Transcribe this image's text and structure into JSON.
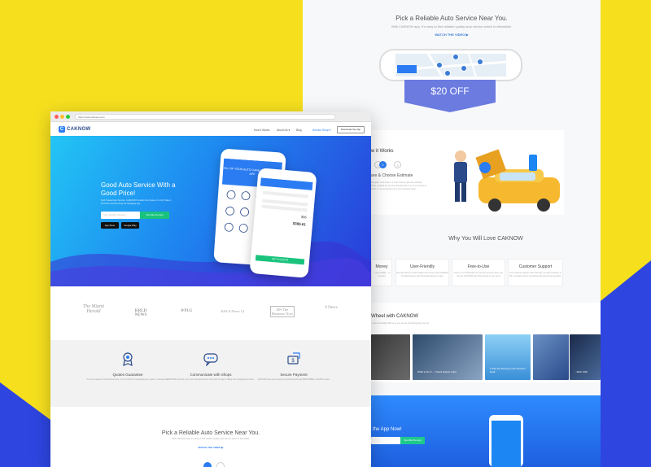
{
  "colors": {
    "background_yellow": "#f6e01e",
    "background_blue": "#2e45e0",
    "brand_blue": "#2b7cf2",
    "cta_green": "#19c37d",
    "offer_purple": "#6b7be0"
  },
  "browser": {
    "url": "https://www.caknow.com"
  },
  "nav": {
    "logo_mark": "C",
    "logo_text": "CAKNOW",
    "items": [
      "How it Works",
      "About Us ▾",
      "Blog",
      "Service Shop ▾"
    ],
    "download_button": "Download the App"
  },
  "hero": {
    "headline": "Good Auto Service With a Good Price!",
    "description": "Find Trusted Auto Service. CAKNOW Provides the Quotes, It's Only Take A Pin Point Can Be Using the Shopping app.",
    "input_placeholder": "Your Mobile Number",
    "cta_button": "Text Me the App",
    "app_store": "App Store",
    "google_play": "Google Play",
    "phone_banner": "ALL OF YOUR AUTO CARE NEEDS IN ONE APP",
    "phone_price": "$396.61",
    "phone_price_small": "$96",
    "phone_quote_button": "GET A QUOTE"
  },
  "press": {
    "logos": [
      "The Miami Herald",
      "KRLD NEWS",
      "WPLG",
      "KSLA News 12",
      "BN The Business Now",
      "9 News"
    ]
  },
  "features": [
    {
      "icon": "award-icon",
      "title": "Quotes Guarantee",
      "desc": "Get more quotes to find the best price, up to 24 hours of requesting your repair or maintenance."
    },
    {
      "icon": "chat-icon",
      "title": "Communicate with Shops",
      "desc": "CAKNOW connects you to your selected service shop with our app's calling and messaging functions."
    },
    {
      "icon": "secure-payment-icon",
      "title": "Secure Payment",
      "desc": "CAKNOW uses secure payment processing through BRAINTREE, a PayPal service."
    }
  ],
  "pick": {
    "title": "Pick a Reliable Auto Service Near You.",
    "subtitle": "With CAKNOW app, it's easy to find reliable quality auto service which is affordable.",
    "watch_link": "WATCH THE VIDEO"
  },
  "back_page": {
    "pick_title": "Pick a Reliable Auto Service Near You.",
    "pick_subtitle": "With CAKNOW app, it's easy to find reliable quality auto service which is affordable.",
    "watch_link": "WATCH THE VIDEO",
    "offer": "$20 OFF",
    "how_title": "w it Works",
    "how_step_label": "are & Choose Estimate",
    "how_text": "Compare more than 1 or 3 but more to give the estimate, these, enlisted the service estimate that on yu is on fit shop to arrive, or can to trusted exit it your personal inbox.",
    "steps": [
      "1",
      "2",
      "3"
    ],
    "love_title": "Why You Will Love CAKNOW",
    "love_cards": [
      {
        "title": "Money",
        "desc": "...ness reliable\n...ut services"
      },
      {
        "title": "User-Friendly",
        "desc": "We help drivers to find reliable and service shop available for appointment, and book appointment in app."
      },
      {
        "title": "Free-to-Use",
        "desc": "There is no subscription to connect services when you use the CAKNOW app. Book shops in your area."
      },
      {
        "title": "Customer Support",
        "desc": "Our customer support team will help you with questions in 24h, and take care of everything that upcoming questions."
      }
    ],
    "wheel_title": "Wheel with CAKNOW",
    "wheel_subtitle": "...ews and installs, Bill us so you can do everything with your car",
    "photos": [
      {
        "caption": ""
      },
      {
        "caption": "What to Do If ... Check Engine Light"
      },
      {
        "caption": "5 Tips For Driving in the Summer Heat"
      },
      {
        "caption": ""
      },
      {
        "caption": "...Stick Shift"
      }
    ],
    "app_title": "the App Now!",
    "app_button": "Text Me the App"
  }
}
